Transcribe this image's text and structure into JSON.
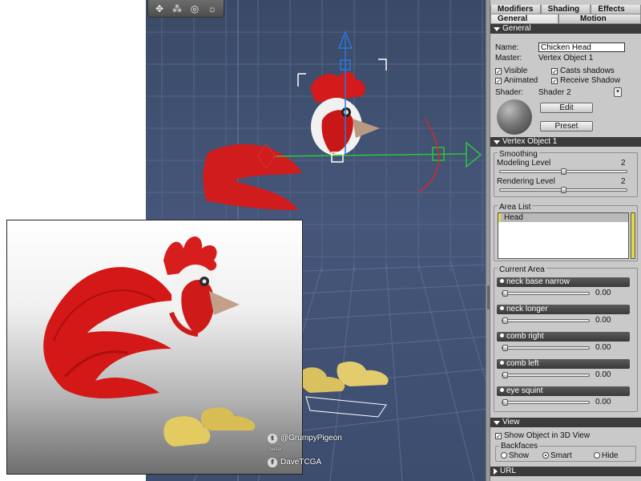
{
  "toolbar": {
    "icons": [
      "camera-move-icon",
      "pan-icon",
      "orbit-icon",
      "sun-icon"
    ]
  },
  "panel": {
    "tabs_top": [
      "Modifiers",
      "Shading",
      "Effects"
    ],
    "tabs_bottom": [
      "General",
      "Motion"
    ],
    "general": {
      "header": "General",
      "name_label": "Name:",
      "name_value": "Chicken Head",
      "master_label": "Master:",
      "master_value": "Vertex Object 1",
      "visible": "Visible",
      "casts_shadows": "Casts shadows",
      "animated": "Animated",
      "receive_shadow": "Receive Shadow",
      "shader_label": "Shader:",
      "shader_value": "Shader 2",
      "edit": "Edit",
      "preset": "Preset"
    },
    "vertex_object": {
      "header": "Vertex Object 1",
      "smoothing": "Smoothing",
      "modeling_level": "Modeling Level",
      "modeling_value": "2",
      "rendering_level": "Rendering Level",
      "rendering_value": "2",
      "area_list": "Area List",
      "area_items": [
        "Head"
      ],
      "current_area": "Current Area",
      "morphs": [
        {
          "label": "neck base narrow",
          "value": "0.00"
        },
        {
          "label": "neck longer",
          "value": "0.00"
        },
        {
          "label": "comb right",
          "value": "0.00"
        },
        {
          "label": "comb left",
          "value": "0.00"
        },
        {
          "label": "eye squint",
          "value": "0.00"
        }
      ]
    },
    "view": {
      "header": "View",
      "show_object": "Show Object in 3D View",
      "backfaces": "Backfaces",
      "options": [
        "Show",
        "Smart",
        "Hide"
      ],
      "selected": "Smart"
    },
    "url": {
      "header": "URL"
    }
  },
  "credits": {
    "twitter_handle": "@GrumpyPigeon",
    "twitter_label": "twitter",
    "facebook_handle": "DaveTCGA"
  }
}
